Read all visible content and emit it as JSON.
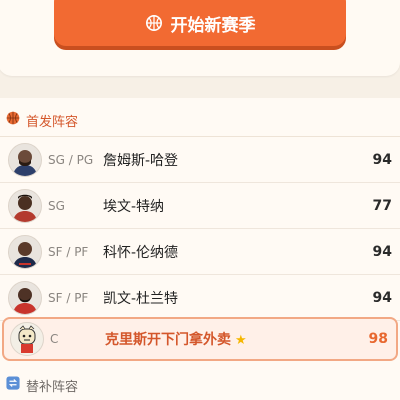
{
  "start_button": {
    "label": "开始新赛季",
    "icon": "basketball-icon"
  },
  "lineup": {
    "title": "首发阵容",
    "players": [
      {
        "position": "SG / PG",
        "name": "詹姆斯-哈登",
        "rating": "94",
        "avatar": "player-avatar-icon"
      },
      {
        "position": "SG",
        "name": "埃文-特纳",
        "rating": "77",
        "avatar": "player-avatar-icon"
      },
      {
        "position": "SF / PF",
        "name": "科怀-伦纳德",
        "rating": "94",
        "avatar": "player-avatar-icon"
      },
      {
        "position": "SF / PF",
        "name": "凯文-杜兰特",
        "rating": "94",
        "avatar": "player-avatar-icon"
      },
      {
        "position": "C",
        "name": "克里斯开下门拿外卖",
        "rating": "98",
        "avatar": "cartoon-avatar-icon",
        "starred": true
      }
    ]
  },
  "bench": {
    "title": "替补阵容",
    "icon": "swap-icon"
  },
  "colors": {
    "accent": "#f26a32",
    "background": "#f7f0e6",
    "highlight_border": "#f2a884"
  }
}
